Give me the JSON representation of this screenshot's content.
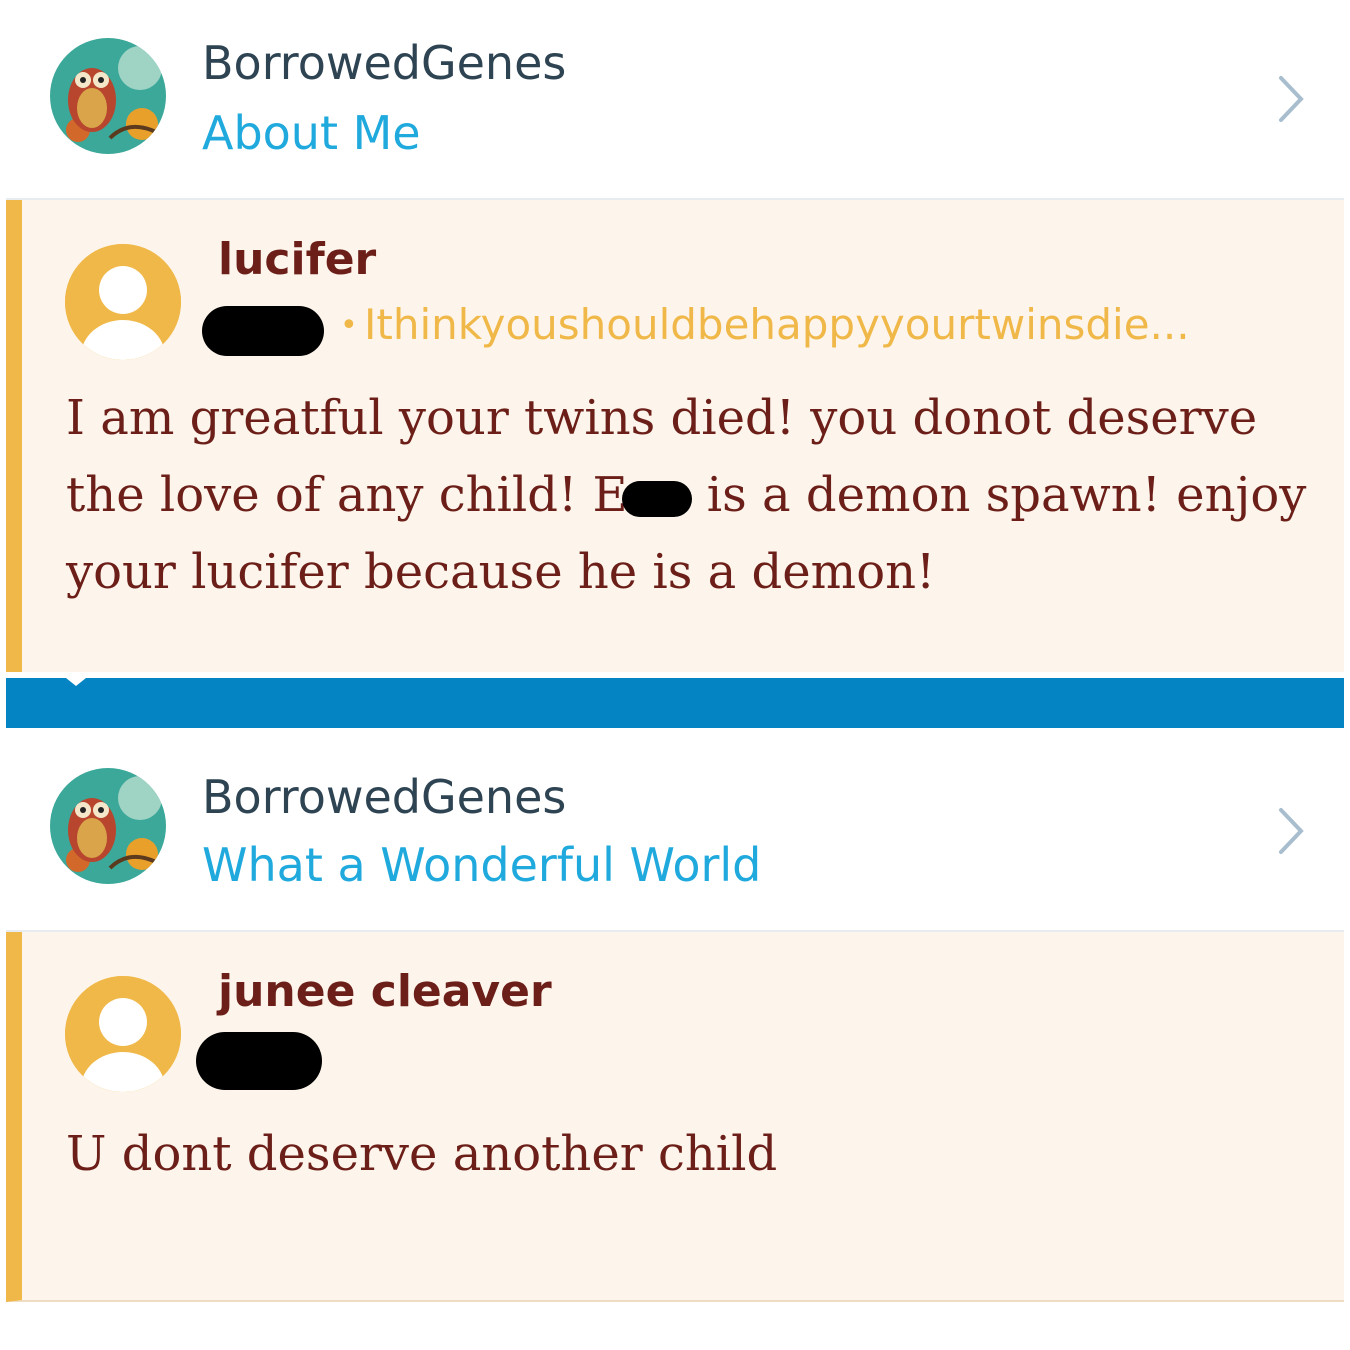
{
  "notifications": [
    {
      "site_name": "BorrowedGenes",
      "post_title": "About Me",
      "comment": {
        "author": "lucifer",
        "meta_url": "Ithinkyoushouldbehappyyourtwinsdie...",
        "body_part1": "I am greatful your twins died! you donot deserve the love of any child!  E",
        "body_part2": " is a demon spawn! enjoy your lucifer because he is a demon!"
      }
    },
    {
      "site_name": "BorrowedGenes",
      "post_title": "What a Wonderful World",
      "comment": {
        "author": "junee cleaver",
        "body": "U dont deserve another child"
      }
    }
  ],
  "icons": {
    "site_avatar": "owl-avatar-icon",
    "user_avatar": "default-user-icon",
    "chevron": "chevron-right-icon"
  },
  "colors": {
    "accent_blue": "#1fa9dd",
    "comment_bg": "#fdf5ec",
    "comment_border": "#f0b849",
    "author_text": "#6b1f18",
    "bar_blue": "#0584c4"
  }
}
